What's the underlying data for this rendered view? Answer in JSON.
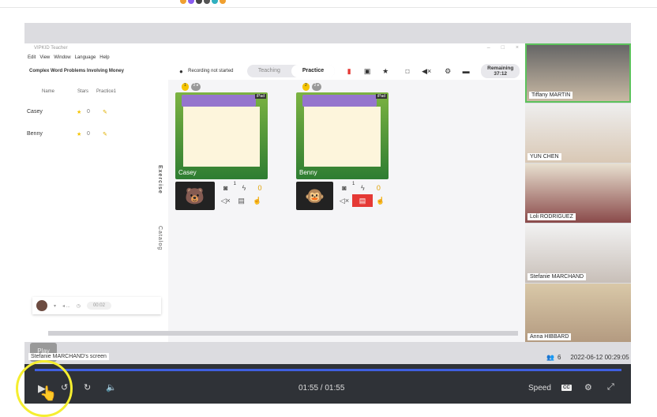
{
  "top_dots": [
    "#f0a030",
    "#8a5cf0",
    "#444",
    "#555",
    "#30b0c0",
    "#f0a030"
  ],
  "app": {
    "title": "VIPKID Teacher",
    "menu": [
      "Edit",
      "View",
      "Window",
      "Language",
      "Help"
    ],
    "lesson": "Complex Word Problems Involving Money",
    "recording": "Recording not started",
    "modes": [
      "Teaching",
      "Practice"
    ],
    "remaining_label": "Remaining",
    "remaining_time": "37:12"
  },
  "table": {
    "headers": [
      "Name",
      "Stars",
      "Practice1"
    ],
    "rows": [
      {
        "name": "Casey",
        "stars": "0"
      },
      {
        "name": "Benny",
        "stars": "0"
      }
    ]
  },
  "side_tabs": [
    "Exercise",
    "Catalog"
  ],
  "bottom_timer": "00:02",
  "cards": [
    {
      "name": "Casey",
      "page": "1",
      "pages": "2 ▸",
      "device": "iPad",
      "count": "1",
      "stars": "0"
    },
    {
      "name": "Benny",
      "page": "2",
      "pages": "2 ▸",
      "device": "iPad",
      "count": "1",
      "stars": "0"
    }
  ],
  "participants": [
    "Tiffany MARTIN",
    "YUN CHEN",
    "Loli RODRIGUEZ",
    "Stefanie MARCHAND",
    "Anna HIBBARD"
  ],
  "tooltip": "Play",
  "screen_label": "Stefanie MARCHAND's screen",
  "viewer_count": "6",
  "datetime": "2022-06-12 00:29:05",
  "player": {
    "time": "01:55 / 01:55",
    "speed": "Speed",
    "cc": "CC",
    "progress_percent": 100
  }
}
